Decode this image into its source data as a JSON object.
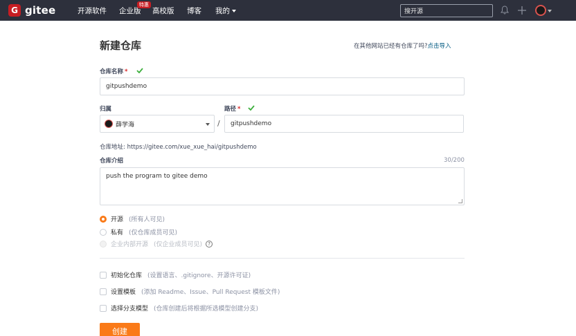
{
  "nav": {
    "logo_glyph": "G",
    "logo_text": "gitee",
    "items": [
      "开源软件",
      "企业版",
      "高校版",
      "博客",
      "我的"
    ],
    "hot_badge": "特惠",
    "search_placeholder": "搜开源"
  },
  "page": {
    "title": "新建仓库",
    "import_question": "在其他网站已经有仓库了吗?",
    "import_link": "点击导入"
  },
  "form": {
    "repo_name_label": "仓库名称",
    "required_mark": "*",
    "repo_name_value": "gitpushdemo",
    "owner_label": "归属",
    "owner_value": "薛学海",
    "path_label": "路径",
    "path_separator": "/",
    "path_value": "gitpushdemo",
    "repo_address": "仓库地址: https://gitee.com/xue_xue_hai/gitpushdemo",
    "intro_label": "仓库介绍",
    "intro_counter": "30/200",
    "intro_value": "push the program to gitee demo",
    "visibility": [
      {
        "label": "开源",
        "desc": "(所有人可见)",
        "checked": true
      },
      {
        "label": "私有",
        "desc": "(仅仓库成员可见)",
        "checked": false
      },
      {
        "label": "企业内部开源",
        "desc": "(仅企业成员可见)",
        "disabled": true
      }
    ],
    "help_glyph": "?",
    "options": [
      {
        "label": "初始化仓库",
        "desc": "(设置语言、.gitignore、开源许可证)"
      },
      {
        "label": "设置模板",
        "desc": "(添加 Readme、Issue、Pull Request 模板文件)"
      },
      {
        "label": "选择分支模型",
        "desc": "(仓库创建后将根据所选模型创建分支)"
      }
    ],
    "create_button": "创建"
  },
  "colors": {
    "brand": "#c71d23",
    "accent": "#fa7a18",
    "topbar": "#2d303c",
    "check": "#3caf3c"
  }
}
